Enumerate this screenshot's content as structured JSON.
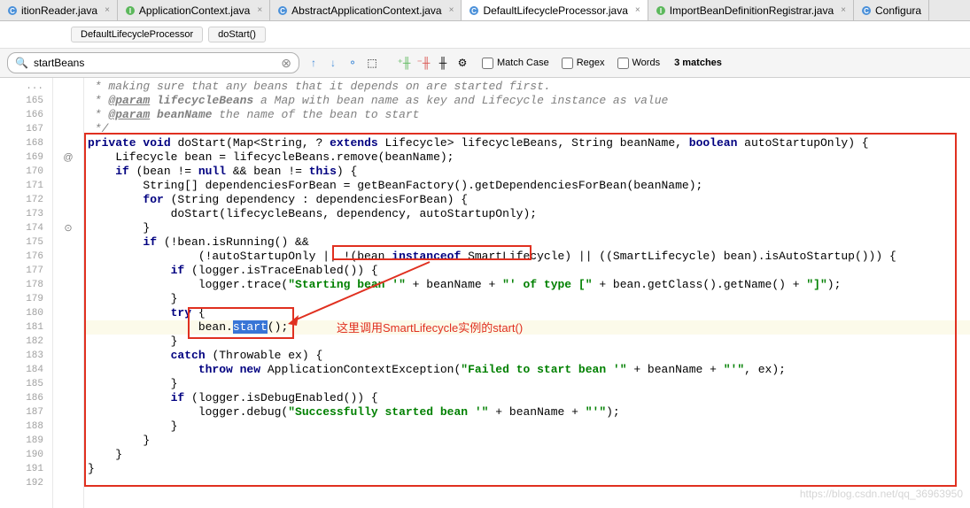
{
  "tabs": [
    {
      "label": "itionReader.java",
      "active": false,
      "icon": "c"
    },
    {
      "label": "ApplicationContext.java",
      "active": false,
      "icon": "i"
    },
    {
      "label": "AbstractApplicationContext.java",
      "active": false,
      "icon": "c"
    },
    {
      "label": "DefaultLifecycleProcessor.java",
      "active": true,
      "icon": "c"
    },
    {
      "label": "ImportBeanDefinitionRegistrar.java",
      "active": false,
      "icon": "i"
    },
    {
      "label": "Configura",
      "active": false,
      "icon": "c"
    }
  ],
  "breadcrumbs": [
    {
      "label": "DefaultLifecycleProcessor"
    },
    {
      "label": "doStart()"
    }
  ],
  "search": {
    "value": "startBeans",
    "matchCase": "Match Case",
    "regex": "Regex",
    "words": "Words",
    "matches": "3 matches"
  },
  "lineNumbers": [
    "...",
    "165",
    "166",
    "167",
    "168",
    "169",
    "170",
    "171",
    "172",
    "173",
    "174",
    "175",
    "176",
    "177",
    "178",
    "179",
    "180",
    "181",
    "182",
    "183",
    "184",
    "185",
    "186",
    "187",
    "188",
    "189",
    "190",
    "191",
    "192"
  ],
  "gutterMarks": {
    "169": "@",
    "174": "⊙"
  },
  "code": {
    "c165": " * making sure that any beans that it depends on are started first.",
    "c166a": " * ",
    "c166b": "@param",
    "c166c": " lifecycleBeans",
    "c166d": " a Map with bean name as key and Lifecycle instance as value",
    "c167a": " * ",
    "c167b": "@param",
    "c167c": " beanName",
    "c167d": " the name of the bean to start",
    "c168": " */",
    "c169": {
      "k1": "private",
      "k2": "void",
      "m": "doStart",
      "p1": "(Map<String, ? ",
      "k3": "extends",
      "p2": " Lifecycle> lifecycleBeans, String beanName, ",
      "k4": "boolean",
      "p3": " autoStartupOnly) {"
    },
    "c170": "    Lifecycle bean = lifecycleBeans.remove(beanName);",
    "c171": {
      "k1": "if",
      "t": " (bean != ",
      "k2": "null",
      "t2": " && bean != ",
      "k3": "this",
      "t3": ") {"
    },
    "c172": "        String[] dependenciesForBean = getBeanFactory().getDependenciesForBean(beanName);",
    "c173": {
      "k1": "for",
      "t": " (String dependency : dependenciesForBean) {"
    },
    "c174": "            doStart(lifecycleBeans, dependency, autoStartupOnly);",
    "c175": "        }",
    "c176": {
      "k1": "if",
      "t": " (!bean.isRunning() &&"
    },
    "c177": {
      "t1": "                (!autoStartupOnly || !(bean ",
      "k1": "instanceof",
      "t2": " SmartLifecycle) || ((SmartLifecycle) bean).isAutoStartup())) {"
    },
    "c178": {
      "k1": "if",
      "t": " (logger.isTraceEnabled()) {"
    },
    "c179": {
      "t1": "                logger.trace(",
      "s1": "\"Starting bean '\"",
      "t2": " + beanName + ",
      "s2": "\"' of type [\"",
      "t3": " + bean.getClass().getName() + ",
      "s3": "\"]\"",
      "t4": ");"
    },
    "c180": "            }",
    "c181": {
      "k1": "try",
      "t": " {"
    },
    "c182": {
      "t1": "                bean.",
      "sel": "start",
      "t2": "();"
    },
    "c183": "            }",
    "c184": {
      "k1": "catch",
      "t": " (Throwable ex) {"
    },
    "c185": {
      "k1": "throw new",
      "t1": " ApplicationContextException(",
      "s1": "\"Failed to start bean '\"",
      "t2": " + beanName + ",
      "s2": "\"'\"",
      "t3": ", ex);"
    },
    "c186": "            }",
    "c187": {
      "k1": "if",
      "t": " (logger.isDebugEnabled()) {"
    },
    "c188": {
      "t1": "                logger.debug(",
      "s1": "\"Successfully started bean '\"",
      "t2": " + beanName + ",
      "s2": "\"'\"",
      "t3": ");"
    },
    "c189": "            }",
    "c190": "        }",
    "c191": "    }",
    "c192": "}"
  },
  "annotation": "这里调用SmartLifecycle实例的start()",
  "watermark": "https://blog.csdn.net/qq_36963950"
}
